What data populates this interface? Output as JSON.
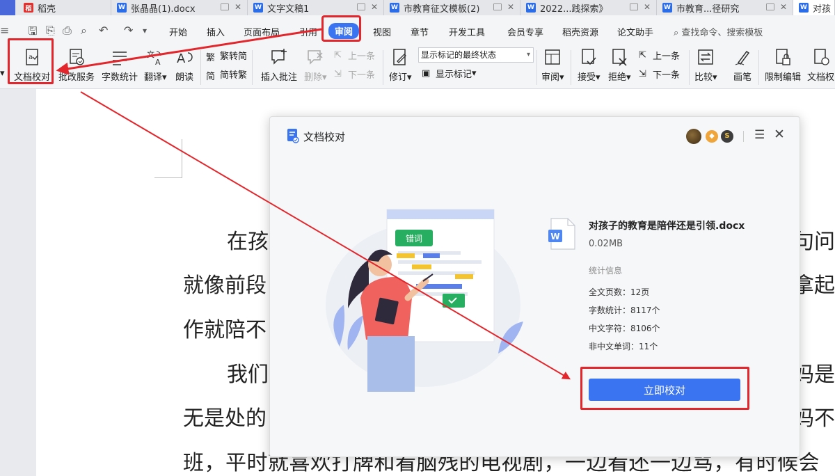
{
  "tabs": [
    {
      "label": "稻壳",
      "icon": "daoke-icon"
    },
    {
      "label": "张晶晶(1).docx",
      "icon": "word-doc-icon"
    },
    {
      "label": "文字文稿1",
      "icon": "word-doc-icon"
    },
    {
      "label": "市教育征文模板(2)",
      "icon": "word-doc-icon"
    },
    {
      "label": "2022...践探索》",
      "icon": "word-doc-icon"
    },
    {
      "label": "市教育...径研究",
      "icon": "word-doc-icon"
    },
    {
      "label": "对孩",
      "icon": "word-doc-icon"
    }
  ],
  "menu": {
    "items": [
      "开始",
      "插入",
      "页面布局",
      "引用",
      "审阅",
      "视图",
      "章节",
      "开发工具",
      "会员专享",
      "稻壳资源",
      "论文助手"
    ],
    "active": "审阅",
    "search_placeholder": "查找命令、搜索模板"
  },
  "ribbon": {
    "doc_proofread": "文档校对",
    "review_service": "批改服务",
    "word_count": "字数统计",
    "translate": "翻译",
    "read_aloud": "朗读",
    "trad_to_simp": "繁转简",
    "simp_to_trad": "简转繁",
    "insert_comment": "插入批注",
    "delete": "删除",
    "prev_item": "上一条",
    "next_item": "下一条",
    "track_changes": "修订",
    "display_state": "显示标记的最终状态",
    "show_markup": "显示标记",
    "review": "审阅",
    "accept": "接受",
    "reject": "拒绝",
    "prev_change": "上一条",
    "next_change": "下一条",
    "compare": "比较",
    "pen": "画笔",
    "restrict_edit": "限制编辑",
    "doc_permission": "文档权"
  },
  "document": {
    "lines": [
      "在孩",
      "句问题",
      "就像前段",
      "拿起工",
      "作就陪不",
      "我们",
      "妈是个",
      "无是处的",
      "妈不上",
      "班，平时就喜欢打牌和看脑残的电视剧，一边看还一边骂，有时候会"
    ]
  },
  "dialog": {
    "title": "文档校对",
    "illustration_tag": "错词",
    "file_name": "对孩子的教育是陪伴还是引领.docx",
    "file_size": "0.02MB",
    "stats_title": "统计信息",
    "stats": [
      "全文页数：12页",
      "字数统计：8117个",
      "中文字符：8106个",
      "非中文单词：11个"
    ],
    "start_button": "立即校对"
  },
  "colors": {
    "accent": "#3b74f0",
    "annotation_red": "#e3262c"
  }
}
